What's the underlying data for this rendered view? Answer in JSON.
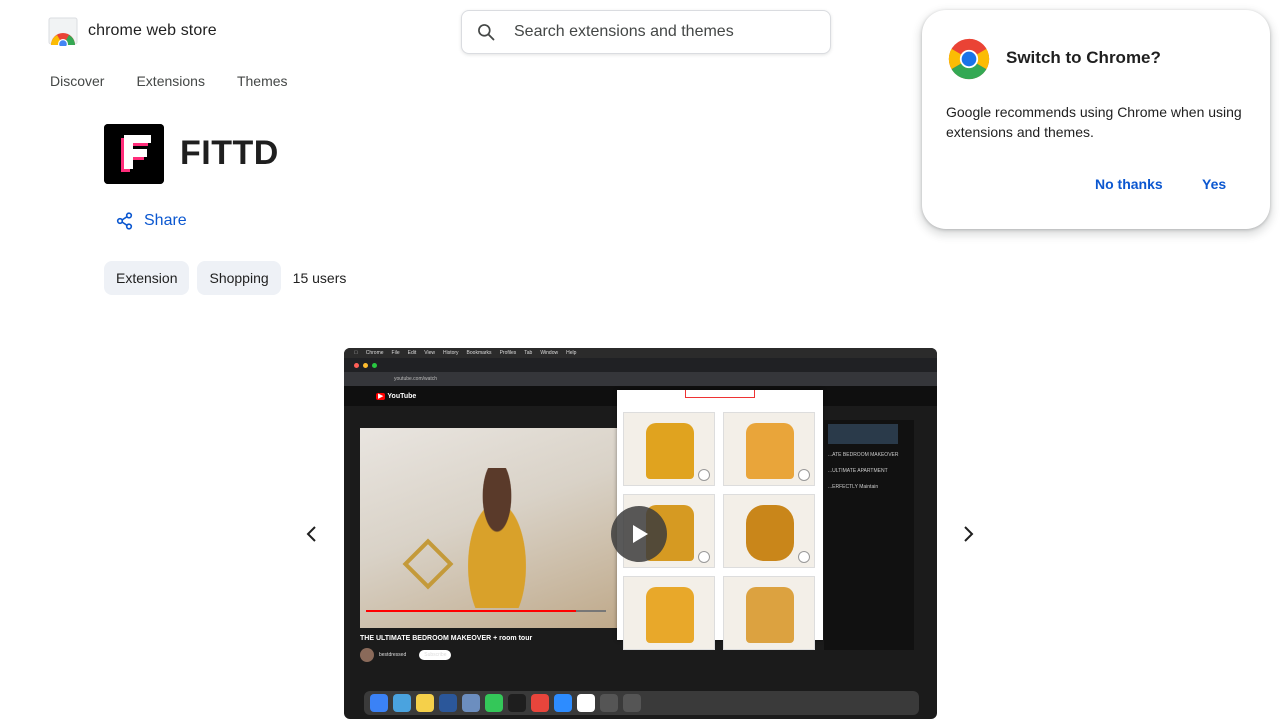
{
  "header": {
    "store_name": "chrome web store",
    "search_placeholder": "Search extensions and themes"
  },
  "nav": {
    "items": [
      {
        "label": "Discover"
      },
      {
        "label": "Extensions"
      },
      {
        "label": "Themes"
      }
    ]
  },
  "item": {
    "name": "FITTD",
    "share_label": "Share",
    "chips": [
      {
        "label": "Extension"
      },
      {
        "label": "Shopping"
      }
    ],
    "users": "15 users"
  },
  "carousel": {
    "prev_icon": "chevron-left-icon",
    "next_icon": "chevron-right-icon",
    "screenshot": {
      "video_title": "THE ULTIMATE BEDROOM MAKEOVER + room tour",
      "channel": "bestdressed",
      "subscribe": "Subscribe",
      "sidebar_items": [
        "...ATE BEDROOM MAKEOVER",
        "...ULTIMATE APARTMENT",
        "...ERFECTLY Maintain"
      ]
    }
  },
  "popup": {
    "title": "Switch to Chrome?",
    "body": "Google recommends using Chrome when using extensions and themes.",
    "no_thanks": "No thanks",
    "yes": "Yes"
  },
  "colors": {
    "link_blue": "#0b57d0",
    "chip_bg": "#eef1f6",
    "chrome_red": "#ea4335",
    "chrome_yellow": "#fbbc04",
    "chrome_green": "#34a853",
    "chrome_blue": "#4285f4",
    "fittd_pink": "#ff2d7a"
  }
}
